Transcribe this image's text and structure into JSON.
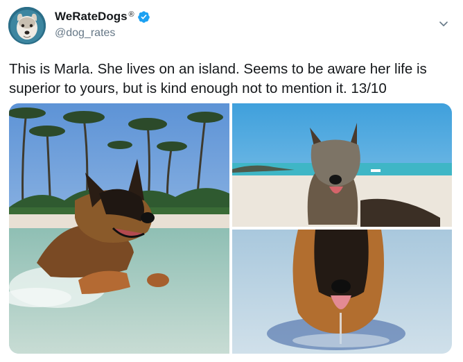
{
  "author": {
    "display_name": "WeRateDogs",
    "registered_mark": "®",
    "handle": "@dog_rates",
    "verified": true,
    "verified_color": "#1da1f2"
  },
  "tweet": {
    "text": "This is Marla. She lives on an island. Seems to be aware her life is superior to yours, but is kind enough not to mention it. 13/10"
  },
  "media": {
    "count": 3,
    "photos": [
      {
        "subject": "german shepherd splashing in shallow water under palm trees"
      },
      {
        "subject": "sandy german shepherd standing on a beach"
      },
      {
        "subject": "german shepherd lying in water with tongue out"
      }
    ]
  },
  "icons": [
    "verified-badge-icon",
    "chevron-down-icon"
  ]
}
